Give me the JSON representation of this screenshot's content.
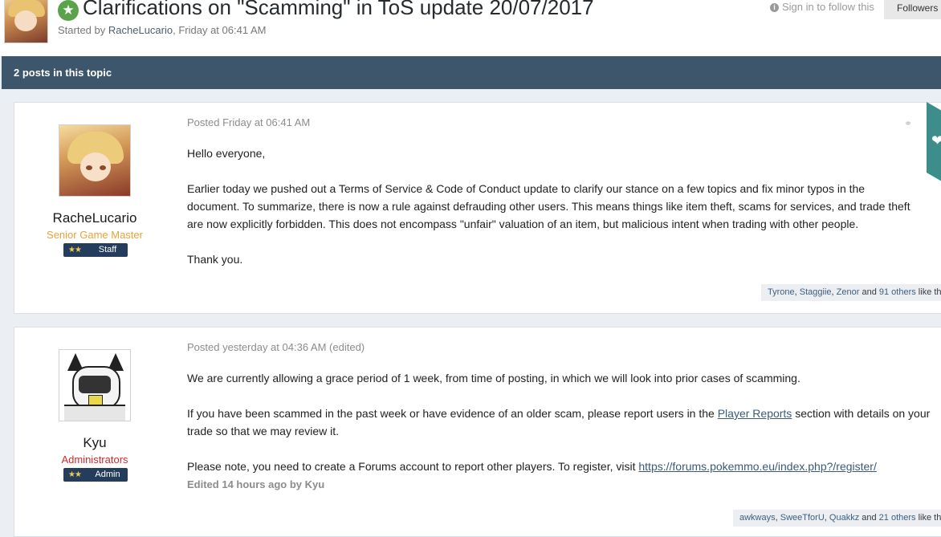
{
  "header": {
    "title": "Clarifications on \"Scamming\" in ToS update 20/07/2017",
    "started_by_prefix": "Started by",
    "author": "RacheLucario",
    "date": ", Friday at 06:41 AM",
    "sign_in_follow": "Sign in to follow this",
    "followers_label": "Followers"
  },
  "topic_bar": {
    "label": "2 posts in this topic"
  },
  "posts": [
    {
      "username": "RacheLucario",
      "rank": "Senior Game Master",
      "badge_stars": "★★",
      "badge_label": "Staff",
      "posted": "Posted Friday at 06:41 AM",
      "paragraphs": [
        "Hello everyone,",
        "Earlier today we pushed out a Terms of Service & Code of Conduct update to clarify our stance on a few topics and fix minor typos in the",
        "document. To summarize, there is now a rule against defrauding other users. This means things like item theft, scams for services, and trade theft",
        "are now explicitly forbidden. This does not encompass \"unfair\" valuation of an item, but malicious intent when trading with other people.",
        "Thank you."
      ],
      "likes": {
        "n1": "Tyrone",
        "sep1": ", ",
        "n2": "Staggiie",
        "sep2": ", ",
        "n3": "Zenor",
        "and": " and ",
        "others": "91 others",
        "tail": " like this"
      }
    },
    {
      "username": "Kyu",
      "rank": "Administrators",
      "badge_stars": "★★",
      "badge_label": "Admin",
      "posted": "Posted yesterday at 04:36 AM  (edited)",
      "p1": "We are currently allowing a grace period of 1 week, from time of posting, in which we will look into prior cases of scamming.",
      "p2_pre": "If you have been scammed in the past week or have evidence of an older scam, please report users in the ",
      "p2_link": "Player Reports",
      "p2_post": " section with details on your",
      "p2_line2": "trade so that we may review it.",
      "p3_pre": "Please note, you need to create a Forums account to report other players. To register, visit ",
      "p3_link": "https://forums.pokemmo.eu/index.php?/register/",
      "edited": "Edited 14 hours ago by Kyu",
      "likes": {
        "n1": "awkways",
        "sep1": ", ",
        "n2": "SweeTforU",
        "sep2": ", ",
        "n3": "Quakkz",
        "and": " and ",
        "others": "21 others",
        "tail": " like this"
      }
    }
  ],
  "colors": {
    "topic_bar": "#3d566b",
    "gm_rank": "#e8a33a",
    "admin_rank": "#d62828",
    "badge": "#243d5c",
    "reaction_tab": "#3d8d8a"
  }
}
